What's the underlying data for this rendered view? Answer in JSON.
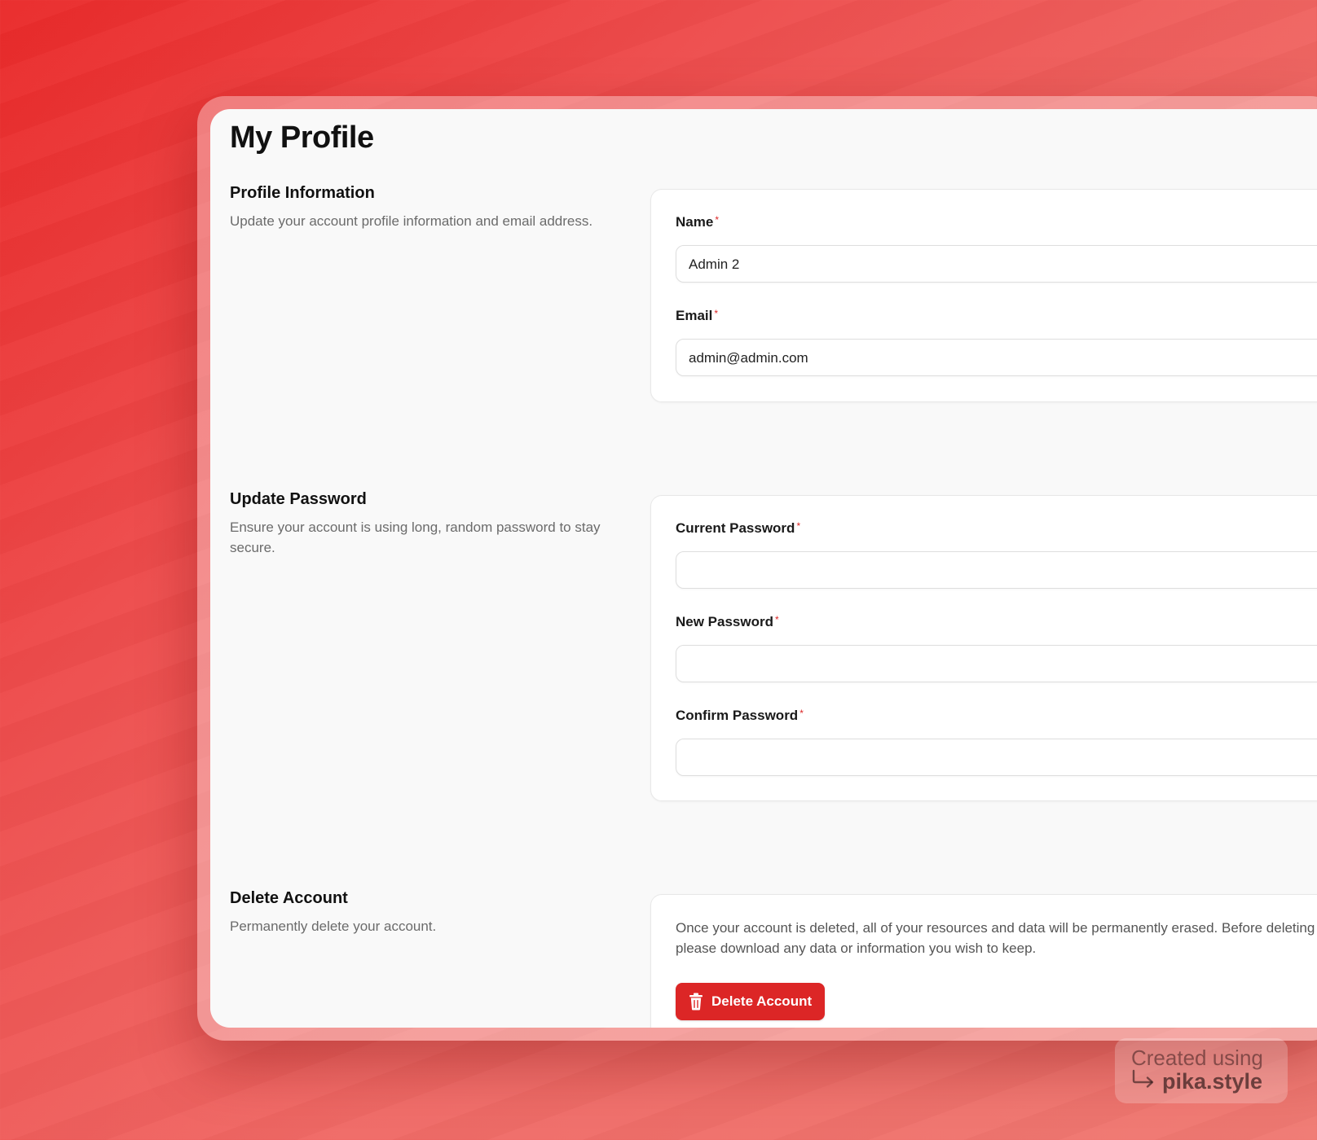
{
  "page": {
    "title": "My Profile"
  },
  "profile_section": {
    "title": "Profile Information",
    "description": "Update your account profile information and email address.",
    "fields": {
      "name": {
        "label": "Name",
        "required_mark": "*",
        "value": "Admin 2"
      },
      "email": {
        "label": "Email",
        "required_mark": "*",
        "value": "admin@admin.com"
      }
    }
  },
  "password_section": {
    "title": "Update Password",
    "description": "Ensure your account is using long, random password to stay secure.",
    "fields": {
      "current": {
        "label": "Current Password",
        "required_mark": "*",
        "value": ""
      },
      "new": {
        "label": "New Password",
        "required_mark": "*",
        "value": ""
      },
      "confirm": {
        "label": "Confirm Password",
        "required_mark": "*",
        "value": ""
      }
    }
  },
  "delete_section": {
    "title": "Delete Account",
    "description": "Permanently delete your account.",
    "warning": "Once your account is deleted, all of your resources and data will be permanently erased. Before deleting your account, please download any data or information you wish to keep.",
    "button_label": "Delete Account",
    "button_icon": "trash-icon"
  },
  "watermark": {
    "line1": "Created using",
    "line2": "pika.style",
    "icon": "arrow-return-icon"
  },
  "colors": {
    "accent": "#dc2626",
    "background_start": "#ea2a2a",
    "background_end": "#f07a73",
    "panel": "#f9f9f9"
  }
}
